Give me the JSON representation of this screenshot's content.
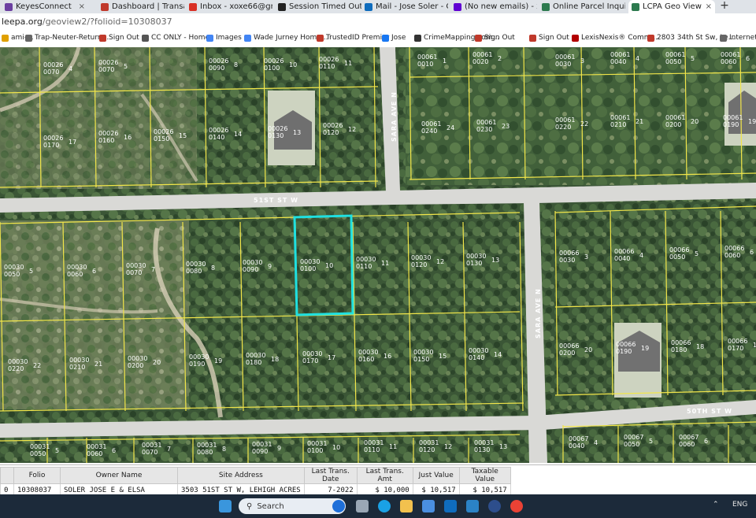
{
  "browser": {
    "tabs": [
      {
        "label": "KeyesConnect",
        "icon": "keyes-icon",
        "color": "#6b3fa0"
      },
      {
        "label": "Dashboard | Transacti",
        "icon": "dashboard-icon",
        "color": "#c0392b"
      },
      {
        "label": "Inbox - xoxe66@gm",
        "icon": "gmail-icon",
        "color": "#d93025"
      },
      {
        "label": "Session Timed Out",
        "icon": "session-icon",
        "color": "#222222"
      },
      {
        "label": "Mail - Jose Soler - O",
        "icon": "outlook-icon",
        "color": "#0f6cbd"
      },
      {
        "label": "(No new emails) - xo",
        "icon": "yahoo-mail-icon",
        "color": "#6001d2"
      },
      {
        "label": "Online Parcel Inquiry",
        "icon": "parcel-icon",
        "color": "#2d7a4f"
      },
      {
        "label": "LCPA Geo View",
        "icon": "geoview-icon",
        "color": "#2d7a4f",
        "active": true
      }
    ],
    "url_domain": "leepa.org",
    "url_path": "/geoview2/?folioid=10308037",
    "bookmarks": [
      {
        "label": "ami-...",
        "icon": "bookmark-icon"
      },
      {
        "label": "Trap-Neuter-Return...",
        "icon": "page-icon"
      },
      {
        "label": "Sign Out",
        "icon": "signout-icon"
      },
      {
        "label": "CC ONLY - Home",
        "icon": "globe-icon"
      },
      {
        "label": "Images",
        "icon": "google-icon"
      },
      {
        "label": "Wade Jurney Home...",
        "icon": "google-icon"
      },
      {
        "label": "TrustedID Premier",
        "icon": "trustedid-icon"
      },
      {
        "label": "Jose",
        "icon": "facebook-icon"
      },
      {
        "label": "CrimeMapping.com...",
        "icon": "crimemapping-icon"
      },
      {
        "label": "Sign Out",
        "icon": "signout-icon"
      },
      {
        "label": "Sign Out",
        "icon": "signout-icon"
      },
      {
        "label": "LexisNexis® Comm...",
        "icon": "lexisnexis-icon"
      },
      {
        "label": "2803 34th St Sw, Le...",
        "icon": "home-icon"
      },
      {
        "label": "Internet H",
        "icon": "page-icon"
      }
    ]
  },
  "map": {
    "streets": [
      "51ST ST W",
      "SARA AVE N",
      "SARA AVE N",
      "50TH ST W"
    ],
    "parcel_labels_row_a": [
      {
        "folio": "00026",
        "sub": "0070",
        "lot": "4"
      },
      {
        "folio": "00026",
        "sub": "0070",
        "lot": "5"
      },
      {
        "folio": "00026",
        "sub": "0090",
        "lot": "8"
      },
      {
        "folio": "00026",
        "sub": "0100",
        "lot": "10"
      },
      {
        "folio": "00026",
        "sub": "0110",
        "lot": "11"
      },
      {
        "folio": "00061",
        "sub": "0010",
        "lot": "1"
      },
      {
        "folio": "00061",
        "sub": "0020",
        "lot": "2"
      },
      {
        "folio": "00061",
        "sub": "0030",
        "lot": "3"
      },
      {
        "folio": "00061",
        "sub": "0040",
        "lot": "4"
      },
      {
        "folio": "00061",
        "sub": "0050",
        "lot": "5"
      },
      {
        "folio": "00061",
        "sub": "0060",
        "lot": "6"
      }
    ],
    "parcel_labels_row_b": [
      {
        "folio": "00026",
        "sub": "0170",
        "lot": "17"
      },
      {
        "folio": "00026",
        "sub": "0160",
        "lot": "16"
      },
      {
        "folio": "00026",
        "sub": "0150",
        "lot": "15"
      },
      {
        "folio": "00026",
        "sub": "0140",
        "lot": "14"
      },
      {
        "folio": "00026",
        "sub": "0130",
        "lot": "13"
      },
      {
        "folio": "00026",
        "sub": "0120",
        "lot": "12"
      },
      {
        "folio": "00061",
        "sub": "0240",
        "lot": "24"
      },
      {
        "folio": "00061",
        "sub": "0230",
        "lot": "23"
      },
      {
        "folio": "00061",
        "sub": "0220",
        "lot": "22"
      },
      {
        "folio": "00061",
        "sub": "0210",
        "lot": "21"
      },
      {
        "folio": "00061",
        "sub": "0200",
        "lot": "20"
      },
      {
        "folio": "00061",
        "sub": "0190",
        "lot": "19"
      }
    ],
    "parcel_labels_row_c": [
      {
        "folio": "00030",
        "sub": "0050",
        "lot": "5"
      },
      {
        "folio": "00030",
        "sub": "0060",
        "lot": "6"
      },
      {
        "folio": "00030",
        "sub": "0070",
        "lot": "7"
      },
      {
        "folio": "00030",
        "sub": "0080",
        "lot": "8"
      },
      {
        "folio": "00030",
        "sub": "0090",
        "lot": "9"
      },
      {
        "folio": "00030",
        "sub": "0100",
        "lot": "10",
        "selected": true
      },
      {
        "folio": "00030",
        "sub": "0110",
        "lot": "11"
      },
      {
        "folio": "00030",
        "sub": "0120",
        "lot": "12"
      },
      {
        "folio": "00030",
        "sub": "0130",
        "lot": "13"
      },
      {
        "folio": "00066",
        "sub": "0030",
        "lot": "3"
      },
      {
        "folio": "00066",
        "sub": "0040",
        "lot": "4"
      },
      {
        "folio": "00066",
        "sub": "0050",
        "lot": "5"
      },
      {
        "folio": "00066",
        "sub": "0060",
        "lot": "6"
      }
    ],
    "parcel_labels_row_d": [
      {
        "folio": "00030",
        "sub": "0220",
        "lot": "22"
      },
      {
        "folio": "00030",
        "sub": "0210",
        "lot": "21"
      },
      {
        "folio": "00030",
        "sub": "0200",
        "lot": "20"
      },
      {
        "folio": "00030",
        "sub": "0190",
        "lot": "19"
      },
      {
        "folio": "00030",
        "sub": "0180",
        "lot": "18"
      },
      {
        "folio": "00030",
        "sub": "0170",
        "lot": "17"
      },
      {
        "folio": "00030",
        "sub": "0160",
        "lot": "16"
      },
      {
        "folio": "00030",
        "sub": "0150",
        "lot": "15"
      },
      {
        "folio": "00030",
        "sub": "0140",
        "lot": "14"
      },
      {
        "folio": "00066",
        "sub": "0200",
        "lot": "20"
      },
      {
        "folio": "00066",
        "sub": "0190",
        "lot": "19"
      },
      {
        "folio": "00066",
        "sub": "0180",
        "lot": "18"
      },
      {
        "folio": "00066",
        "sub": "0170",
        "lot": "17"
      }
    ],
    "parcel_labels_row_e": [
      {
        "folio": "00031",
        "sub": "0050",
        "lot": "5"
      },
      {
        "folio": "00031",
        "sub": "0060",
        "lot": "6"
      },
      {
        "folio": "00031",
        "sub": "0070",
        "lot": "7"
      },
      {
        "folio": "00031",
        "sub": "0080",
        "lot": "8"
      },
      {
        "folio": "00031",
        "sub": "0090",
        "lot": "9"
      },
      {
        "folio": "00031",
        "sub": "0100",
        "lot": "10"
      },
      {
        "folio": "00031",
        "sub": "0110",
        "lot": "11"
      },
      {
        "folio": "00031",
        "sub": "0120",
        "lot": "12"
      },
      {
        "folio": "00031",
        "sub": "0130",
        "lot": "13"
      },
      {
        "folio": "00067",
        "sub": "0040",
        "lot": "4"
      },
      {
        "folio": "00067",
        "sub": "0050",
        "lot": "5"
      },
      {
        "folio": "00067",
        "sub": "0060",
        "lot": "6"
      }
    ],
    "colors": {
      "parcel_line": "#f2e64a",
      "selected_outline": "#1fe0e0",
      "road": "#d9d9d6"
    }
  },
  "results": {
    "headers": [
      "",
      "Folio",
      "Owner Name",
      "Site Address",
      "Last Trans. Date",
      "Last Trans. Amt",
      "Just Value",
      "Taxable Value"
    ],
    "row": [
      "0",
      "10308037",
      "SOLER JOSE E & ELSA",
      "3503 51ST ST W, LEHIGH ACRES",
      "7-2022",
      "$ 10,000",
      "$ 10,517",
      "$ 10,517"
    ]
  },
  "taskbar": {
    "search_placeholder": "Search",
    "apps": [
      "windows-start-icon",
      "bing-icon",
      "task-view-icon",
      "edge-icon",
      "file-explorer-icon",
      "store-icon",
      "outlook-icon",
      "browser-icon",
      "m-app-icon",
      "chrome-icon"
    ],
    "tray_text": "ENG"
  }
}
